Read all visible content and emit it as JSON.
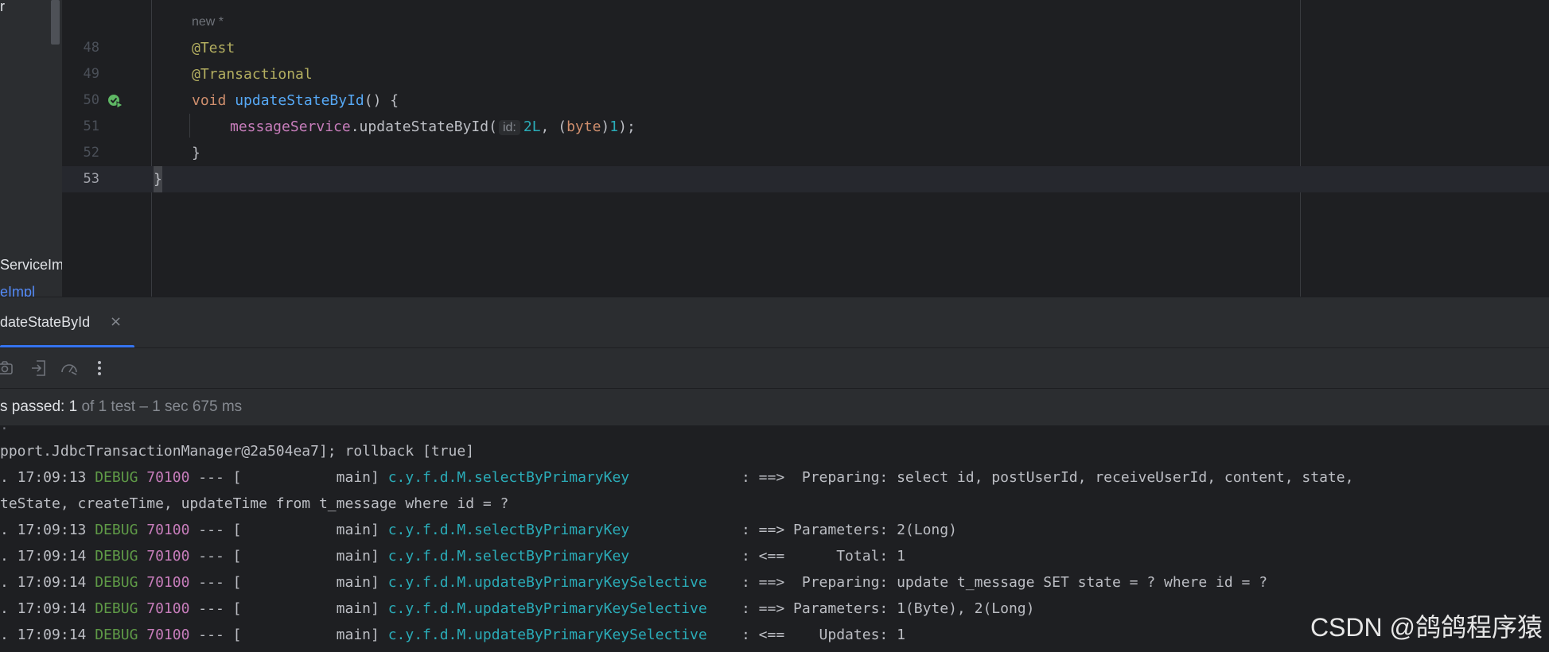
{
  "project_panel": {
    "top_fragment": "r",
    "fragment_1": "ServiceIm",
    "fragment_2": "eImpl"
  },
  "editor": {
    "author_hint": "new *",
    "lines": [
      {
        "num": "48",
        "ann": "@Test"
      },
      {
        "num": "49",
        "ann": "@Transactional"
      },
      {
        "num": "50",
        "kw": "void",
        "fn": "updateStateById",
        "rest": "() {"
      },
      {
        "num": "51",
        "field": "messageService",
        "call": ".updateStateById(",
        "inlay": "id:",
        "arg1": "2L",
        "sep": ", (",
        "cast": "byte",
        "close_paren": ")",
        "arg2": "1",
        "end": ");"
      },
      {
        "num": "52",
        "text": "}"
      },
      {
        "num": "53",
        "text": "}"
      }
    ]
  },
  "run_window": {
    "tab_label": "dateStateById",
    "tab_close": "×",
    "status_passed": "s passed: 1",
    "status_rest": " of 1 test – 1 sec 675 ms"
  },
  "console": {
    "lines": [
      {
        "plain": "pport.JdbcTransactionManager@2a504ea7]; rollback [true]"
      },
      {
        "time": ". 17:09:13 ",
        "level": "DEBUG",
        "pid": " 70100",
        "mid": " --- [           main] ",
        "logger": "c.y.f.d.M.selectByPrimaryKey            ",
        "msg": " : ==>  Preparing: select id, postUserId, receiveUserId, content, state,"
      },
      {
        "plain": "teState, createTime, updateTime from t_message where id = ?"
      },
      {
        "time": ". 17:09:13 ",
        "level": "DEBUG",
        "pid": " 70100",
        "mid": " --- [           main] ",
        "logger": "c.y.f.d.M.selectByPrimaryKey            ",
        "msg": " : ==> Parameters: 2(Long)"
      },
      {
        "time": ". 17:09:14 ",
        "level": "DEBUG",
        "pid": " 70100",
        "mid": " --- [           main] ",
        "logger": "c.y.f.d.M.selectByPrimaryKey            ",
        "msg": " : <==      Total: 1"
      },
      {
        "time": ". 17:09:14 ",
        "level": "DEBUG",
        "pid": " 70100",
        "mid": " --- [           main] ",
        "logger": "c.y.f.d.M.updateByPrimaryKeySelective   ",
        "msg": " : ==>  Preparing: update t_message SET state = ? where id = ?"
      },
      {
        "time": ". 17:09:14 ",
        "level": "DEBUG",
        "pid": " 70100",
        "mid": " --- [           main] ",
        "logger": "c.y.f.d.M.updateByPrimaryKeySelective   ",
        "msg": " : ==> Parameters: 1(Byte), 2(Long)"
      },
      {
        "time": ". 17:09:14 ",
        "level": "DEBUG",
        "pid": " 70100",
        "mid": " --- [           main] ",
        "logger": "c.y.f.d.M.updateByPrimaryKeySelective   ",
        "msg": " : <==    Updates: 1"
      }
    ]
  },
  "watermark": "CSDN @鸽鸽程序猿",
  "colors": {
    "editor_bg": "#1e1f22",
    "panel_bg": "#2b2d30",
    "annotation": "#b3ae60",
    "keyword": "#cf8e6d",
    "function": "#56a8f5",
    "field": "#c77dbb",
    "number": "#2aacb8",
    "debug": "#5f9a47",
    "accent": "#3574f0"
  }
}
